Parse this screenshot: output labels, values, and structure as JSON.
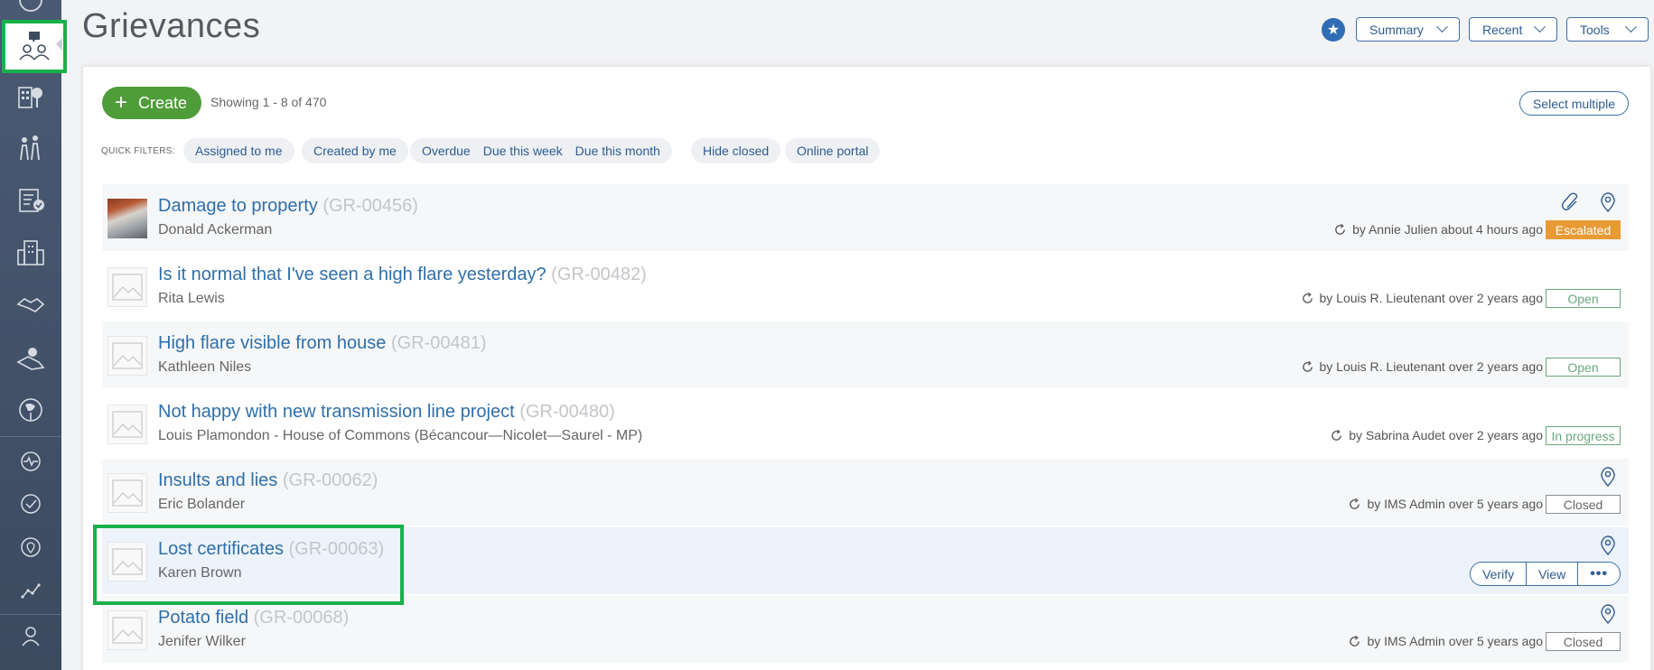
{
  "header": {
    "title": "Grievances",
    "summary_label": "Summary",
    "recent_label": "Recent",
    "tools_label": "Tools"
  },
  "toolbar": {
    "create_label": "Create",
    "showing_text": "Showing 1 - 8 of 470",
    "select_multiple_label": "Select multiple"
  },
  "quick_filters": {
    "label": "QUICK FILTERS:",
    "items": [
      "Assigned to me",
      "Created by me",
      "Overdue",
      "Due this week",
      "Due this month",
      "Hide closed",
      "Online portal"
    ]
  },
  "rows": [
    {
      "title": "Damage to property",
      "code": "(GR-00456)",
      "person": "Donald Ackerman",
      "meta": "by Annie Julien about 4 hours ago",
      "status": "Escalated"
    },
    {
      "title": "Is it normal that I've seen a high flare yesterday?",
      "code": "(GR-00482)",
      "person": "Rita Lewis",
      "meta": "by Louis R. Lieutenant over 2 years ago",
      "status": "Open"
    },
    {
      "title": "High flare visible from house",
      "code": "(GR-00481)",
      "person": "Kathleen Niles",
      "meta": "by Louis R. Lieutenant over 2 years ago",
      "status": "Open"
    },
    {
      "title": "Not happy with new transmission line project",
      "code": "(GR-00480)",
      "person": "Louis Plamondon - House of Commons (Bécancour—Nicolet—Saurel - MP)",
      "meta": "by Sabrina Audet over 2 years ago",
      "status": "In progress"
    },
    {
      "title": "Insults and lies",
      "code": "(GR-00062)",
      "person": "Eric Bolander",
      "meta": "by IMS Admin over 5 years ago",
      "status": "Closed"
    },
    {
      "title": "Lost certificates",
      "code": "(GR-00063)",
      "person": "Karen Brown",
      "actions": {
        "verify": "Verify",
        "view": "View",
        "more": "•••"
      }
    },
    {
      "title": "Potato field",
      "code": "(GR-00068)",
      "person": "Jenifer Wilker",
      "meta": "by IMS Admin over 5 years ago",
      "status": "Closed"
    }
  ],
  "colors": {
    "accent": "#2f6fa9",
    "create": "#4f9d3a",
    "escalated": "#e89a35",
    "highlight": "#19b14b",
    "sidebar": "#44536b"
  }
}
